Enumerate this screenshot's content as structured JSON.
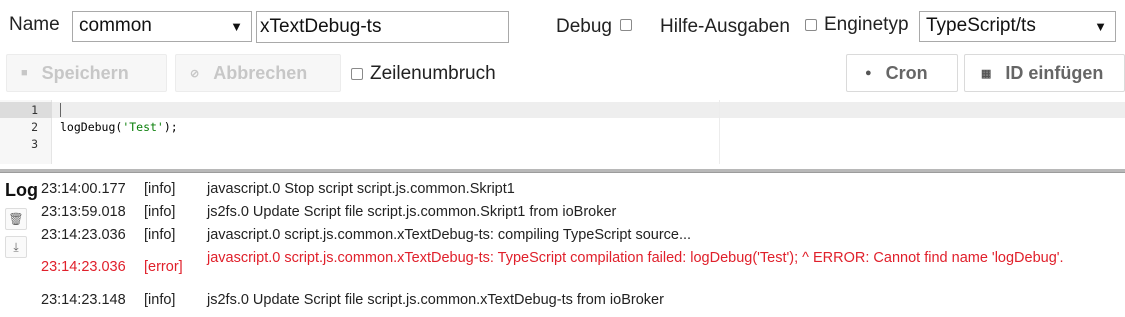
{
  "header": {
    "name_label": "Name",
    "folder_select": "common",
    "script_name": "xTextDebug-ts",
    "debug_label": "Debug",
    "hilfe_label": "Hilfe-Ausgaben",
    "enginetyp_label": "Enginetyp",
    "engine_select": "TypeScript/ts"
  },
  "toolbar": {
    "save_label": "Speichern",
    "cancel_label": "Abbrechen",
    "wrap_label": "Zeilenumbruch",
    "cron_label": "Cron",
    "id_label": "ID einfügen"
  },
  "editor": {
    "line_numbers": [
      "1",
      "2",
      "3"
    ],
    "lines": [
      "",
      "logDebug('Test');",
      ""
    ],
    "code_prefix": "logDebug(",
    "code_string": "'Test'",
    "code_suffix": ");"
  },
  "log": {
    "title": "Log",
    "entries": [
      {
        "time": "23:14:00.177",
        "level": "[info]",
        "message": "javascript.0 Stop script script.js.common.Skript1"
      },
      {
        "time": "23:13:59.018",
        "level": "[info]",
        "message": "js2fs.0 Update Script file script.js.common.Skript1 from ioBroker"
      },
      {
        "time": "23:14:23.036",
        "level": "[info]",
        "message": "javascript.0 script.js.common.xTextDebug-ts: compiling TypeScript source..."
      },
      {
        "time": "23:14:23.036",
        "level": "[error]",
        "message": "javascript.0 script.js.common.xTextDebug-ts: TypeScript compilation failed: logDebug('Test'); ^ ERROR: Cannot find name 'logDebug'."
      },
      {
        "time": "23:14:23.148",
        "level": "[info]",
        "message": "js2fs.0 Update Script file script.js.common.xTextDebug-ts from ioBroker"
      }
    ]
  },
  "colors": {
    "error": "#e0202b",
    "string": "#0a7f0a",
    "disabled_text": "#c7c7c7"
  },
  "icons": {
    "save": "floppy-icon",
    "cancel": "cancel-icon",
    "cron": "clock-icon",
    "id": "list-icon",
    "clear": "trash-icon",
    "download": "download-icon"
  }
}
